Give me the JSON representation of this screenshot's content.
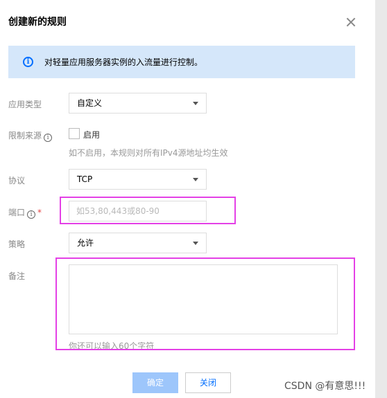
{
  "dialog": {
    "title": "创建新的规则",
    "notice": "对轻量应用服务器实例的入流量进行控制。"
  },
  "form": {
    "app_type": {
      "label": "应用类型",
      "value": "自定义"
    },
    "source_limit": {
      "label": "限制来源",
      "checkbox_label": "启用",
      "checked": false,
      "hint": "如不启用，本规则对所有IPv4源地址均生效"
    },
    "protocol": {
      "label": "协议",
      "value": "TCP"
    },
    "port": {
      "label": "端口",
      "required_mark": "*",
      "placeholder": "如53,80,443或80-90",
      "value": ""
    },
    "policy": {
      "label": "策略",
      "value": "允许"
    },
    "remark": {
      "label": "备注",
      "value": "",
      "hint": "你还可以输入60个字符"
    }
  },
  "footer": {
    "confirm_label": "确定",
    "close_label": "关闭"
  },
  "watermark": "CSDN @有意思!!!",
  "colors": {
    "accent": "#006eff",
    "notice_bg": "#d5e7fa",
    "annotation_box": "#e440e6",
    "confirm_disabled": "#9dc6fb"
  },
  "icons": {
    "close": "close-icon",
    "info": "info-icon"
  }
}
